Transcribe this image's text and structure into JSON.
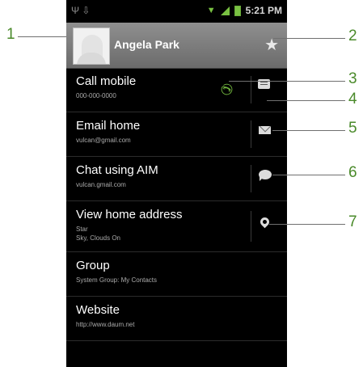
{
  "status_bar": {
    "time": "5:21 PM",
    "left_icons": [
      "usb-icon",
      "download-icon"
    ],
    "right_icons": [
      "wifi-icon",
      "signal-icon",
      "battery-icon"
    ]
  },
  "contact": {
    "name": "Angela Park",
    "photo": "contact-photo-placeholder",
    "starred_icon": "star-icon"
  },
  "rows": [
    {
      "title": "Call mobile",
      "subtitle": "000-000-0000",
      "icons": [
        "phone-icon",
        "message-icon"
      ]
    },
    {
      "title": "Email home",
      "subtitle": "vulcan@gmail.com",
      "icons": [
        "envelope-icon"
      ]
    },
    {
      "title": "Chat using AIM",
      "subtitle": "vulcan.gmail.com",
      "icons": [
        "chat-bubble-icon"
      ]
    },
    {
      "title": "View home address",
      "subtitle_lines": [
        "Star",
        "Sky, Clouds On"
      ],
      "icons": [
        "map-pin-icon"
      ]
    },
    {
      "title": "Group",
      "subtitle": "System Group: My Contacts"
    },
    {
      "title": "Website",
      "subtitle": "http://www.daum.net"
    }
  ],
  "callouts": [
    "1",
    "2",
    "3",
    "4",
    "5",
    "6",
    "7"
  ],
  "colors": {
    "callout_green": "#4a8a2a",
    "phone_green": "#71b53e",
    "header_gray": "#7d7d7d"
  }
}
